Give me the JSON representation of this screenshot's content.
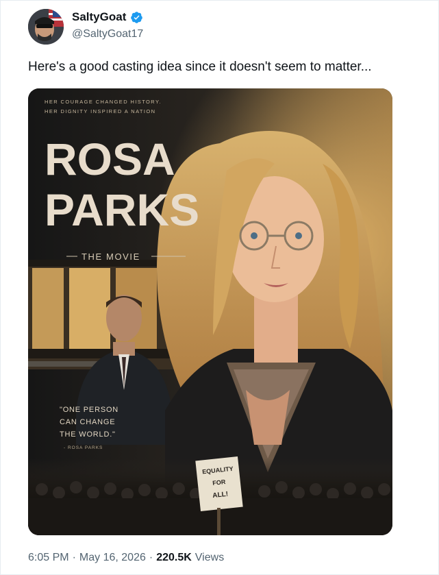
{
  "author": {
    "display_name": "SaltyGoat",
    "handle": "@SaltyGoat17",
    "verified": true
  },
  "tweet": {
    "text": "Here's a good casting idea since it doesn't seem to matter..."
  },
  "poster": {
    "tagline_1": "HER COURAGE CHANGED HISTORY.",
    "tagline_2": "HER DIGNITY INSPIRED A NATION",
    "title_1": "ROSA",
    "title_2": "PARKS",
    "subtitle": "THE MOVIE",
    "quote_1": "\"ONE PERSON",
    "quote_2": "CAN CHANGE",
    "quote_3": "THE WORLD.\"",
    "quote_attribution": "- ROSA PARKS",
    "sign_1": "EQUALITY",
    "sign_2": "FOR",
    "sign_3": "ALL!"
  },
  "meta": {
    "time": "6:05 PM",
    "separator": "·",
    "date": "May 16, 2026",
    "views_count": "220.5K",
    "views_label": "Views"
  },
  "colors": {
    "verified_blue": "#1d9bf0",
    "text_primary": "#0f1419",
    "text_secondary": "#536471"
  }
}
